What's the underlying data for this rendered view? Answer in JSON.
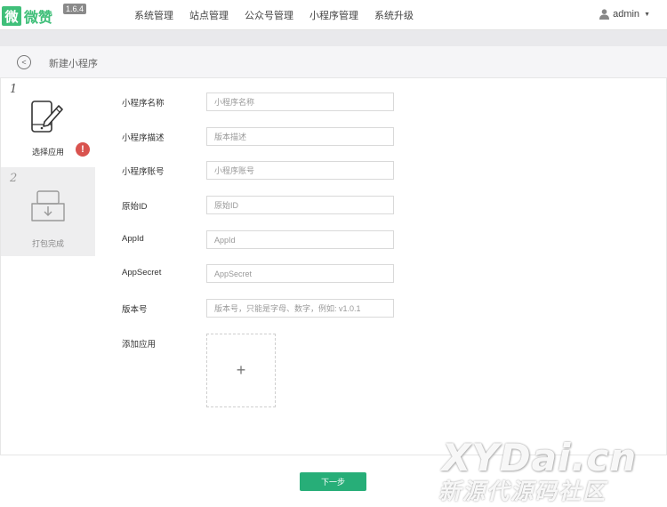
{
  "header": {
    "logo_glyph": "微",
    "logo_text": "微赞",
    "version": "1.6.4",
    "nav": [
      "系统管理",
      "站点管理",
      "公众号管理",
      "小程序管理",
      "系统升级"
    ],
    "user": "admin"
  },
  "page": {
    "title": "新建小程序"
  },
  "steps": [
    {
      "number": "1",
      "label": "选择应用",
      "alert": "!"
    },
    {
      "number": "2",
      "label": "打包完成"
    }
  ],
  "form": {
    "fields": [
      {
        "label": "小程序名称",
        "placeholder": "小程序名称"
      },
      {
        "label": "小程序描述",
        "placeholder": "版本描述"
      },
      {
        "label": "小程序账号",
        "placeholder": "小程序账号"
      },
      {
        "label": "原始ID",
        "placeholder": "原始ID"
      },
      {
        "label": "AppId",
        "placeholder": "AppId"
      },
      {
        "label": "AppSecret",
        "placeholder": "AppSecret"
      },
      {
        "label": "版本号",
        "placeholder": "版本号，只能是字母、数字，例如: v1.0.1"
      }
    ],
    "add_app_label": "添加应用",
    "add_symbol": "+"
  },
  "footer": {
    "next_label": "下一步"
  },
  "watermark": {
    "line1": "XYDai.cn",
    "line2": "新源代源码社区"
  },
  "colors": {
    "brand_green": "#3fbf79",
    "button_green": "#27ae78",
    "alert_red": "#d9534f"
  }
}
